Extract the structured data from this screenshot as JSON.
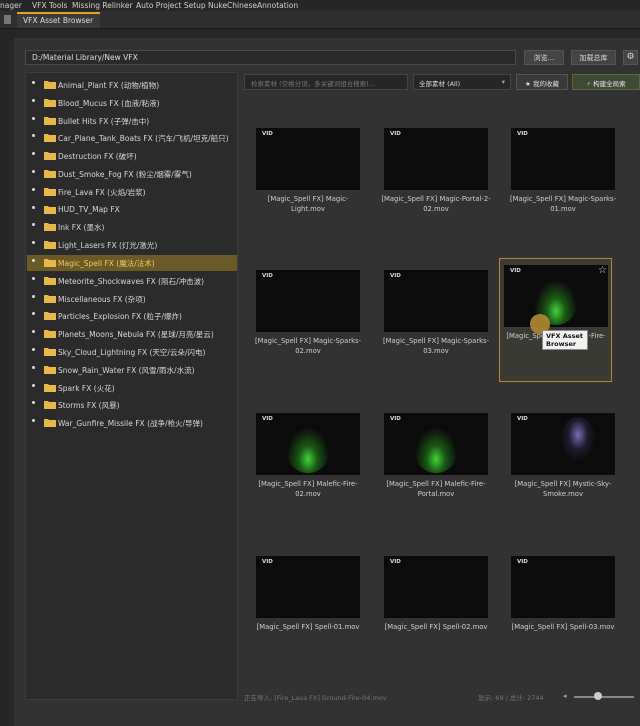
{
  "menu": [
    {
      "label": "nager"
    },
    {
      "label": "VFX Tools"
    },
    {
      "label": "Missing Relinker"
    },
    {
      "label": "Auto Project Setup"
    },
    {
      "label": "NukeChineseAnnotation"
    }
  ],
  "tab": {
    "title": "VFX Asset Browser"
  },
  "path": {
    "value": "D:/Material Library/New VFX"
  },
  "buttons": {
    "browse": "浏览...",
    "load": "加载总库",
    "favorites": "★ 我的收藏",
    "build_index": "构建全局索"
  },
  "search": {
    "placeholder": "检索素材 (空格分词，多关键词组合搜索)..."
  },
  "filter": {
    "value": "全部素材 (All)"
  },
  "categories": [
    {
      "label": "Animal_Plant FX (动物/植物)"
    },
    {
      "label": "Blood_Mucus FX (血液/粘液)"
    },
    {
      "label": "Bullet Hits FX (子弹/击中)"
    },
    {
      "label": "Car_Plane_Tank_Boats FX (汽车/飞机/坦克/船只)"
    },
    {
      "label": "Destruction FX (破坏)"
    },
    {
      "label": "Dust_Smoke_Fog FX (粉尘/烟雾/雾气)"
    },
    {
      "label": "Fire_Lava FX (火焰/岩浆)"
    },
    {
      "label": "HUD_TV_Map FX"
    },
    {
      "label": "Ink FX (墨水)"
    },
    {
      "label": "Light_Lasers FX (灯光/激光)"
    },
    {
      "label": "Magic_Spell FX (魔法/法术)"
    },
    {
      "label": "Meteorite_Shockwaves FX (陨石/冲击波)"
    },
    {
      "label": "Miscellaneous FX (杂项)"
    },
    {
      "label": "Particles_Explosion FX (粒子/爆炸)"
    },
    {
      "label": "Planets_Moons_Nebula FX (星球/月亮/星云)"
    },
    {
      "label": "Sky_Cloud_Lightning FX (天空/云朵/闪电)"
    },
    {
      "label": "Snow_Rain_Water FX (风雪/雨水/水流)"
    },
    {
      "label": "Spark FX (火花)"
    },
    {
      "label": "Storms FX (风暴)"
    },
    {
      "label": "War_Gunfire_Missile FX (战争/枪火/导弹)"
    }
  ],
  "selected_category_index": 10,
  "assets": [
    {
      "badge": "VID",
      "name": "[Magic_Spell FX] Magic-Light.mov",
      "fx": "none"
    },
    {
      "badge": "VID",
      "name": "[Magic_Spell FX] Magic-Portal-2-02.mov",
      "fx": "none"
    },
    {
      "badge": "VID",
      "name": "[Magic_Spell FX] Magic-Sparks-01.mov",
      "fx": "none"
    },
    {
      "badge": "VID",
      "name": "[Magic_Spell FX] Magic-Sparks-02.mov",
      "fx": "none"
    },
    {
      "badge": "VID",
      "name": "[Magic_Spell FX] Magic-Sparks-03.mov",
      "fx": "none"
    },
    {
      "badge": "VID",
      "name": "[Magic_Spell FX] Malefic-Fire-",
      "fx": "green",
      "selected": true,
      "star": "☆"
    },
    {
      "badge": "VID",
      "name": "[Magic_Spell FX] Malefic-Fire-02.mov",
      "fx": "green"
    },
    {
      "badge": "VID",
      "name": "[Magic_Spell FX] Malefic-Fire-Portal.mov",
      "fx": "green"
    },
    {
      "badge": "VID",
      "name": "[Magic_Spell FX] Mystic-Sky-Smoke.mov",
      "fx": "purple"
    },
    {
      "badge": "VID",
      "name": "[Magic_Spell FX] Spell-01.mov",
      "fx": "none"
    },
    {
      "badge": "VID",
      "name": "[Magic_Spell FX] Spell-02.mov",
      "fx": "none"
    },
    {
      "badge": "VID",
      "name": "[Magic_Spell FX] Spell-03.mov",
      "fx": "none"
    }
  ],
  "tooltip": {
    "text": "VFX Asset Browser"
  },
  "status": {
    "importing": "正在导入: [Fire_Lava FX] Ground-Fire-04.mov",
    "count": "显示: 69 / 总计: 2744"
  },
  "colors": {
    "accent": "#e0a320",
    "selected_bg": "#6b5a27",
    "folder": "#e8b84a",
    "fx_green": "#3fd23a",
    "fx_purple": "#7a6ab0"
  },
  "icons": {
    "folder": "folder-icon",
    "settings": "gear-icon",
    "star": "star-icon",
    "zoom": "zoom-slider"
  }
}
